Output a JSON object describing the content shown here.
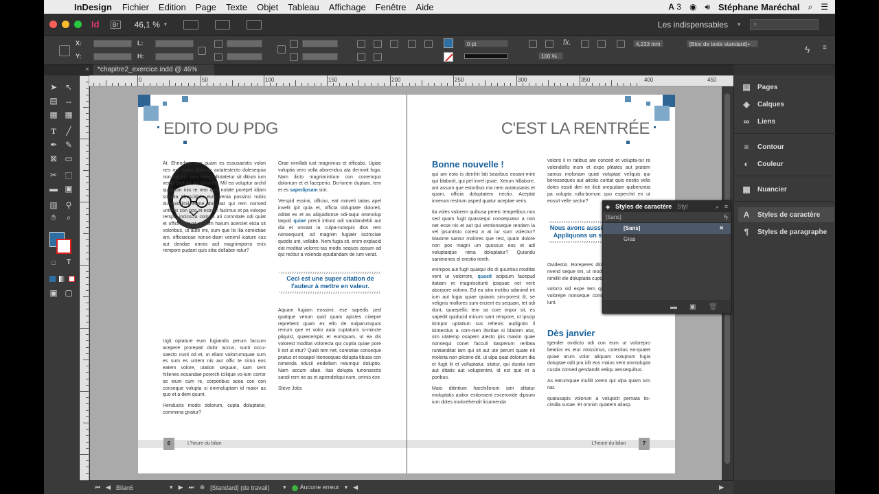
{
  "menubar": {
    "app_name": "InDesign",
    "items": [
      "Fichier",
      "Edition",
      "Page",
      "Texte",
      "Objet",
      "Tableau",
      "Affichage",
      "Fenêtre",
      "Aide"
    ],
    "adobe_count": "3",
    "user": "Stéphane Maréchal"
  },
  "appbar": {
    "br_label": "Br",
    "zoom": "46,1 %",
    "workspace": "Les indispensables"
  },
  "control": {
    "x_label": "X:",
    "y_label": "Y:",
    "l_label": "L:",
    "h_label": "H:",
    "stroke_weight": "0 pt",
    "opacity": "100 %",
    "gutter": "4,233 mm",
    "frame_style": "[Bloc de texte standard]+"
  },
  "document": {
    "tab_title": "*chapitre2_exercice.indd @ 46%"
  },
  "ruler": {
    "labels": [
      "0",
      "50",
      "100",
      "150",
      "200",
      "250",
      "300",
      "350",
      "400",
      "450"
    ]
  },
  "left_page": {
    "title": "EDITO DU PDG",
    "intro": "At. Ehendicto-rum quam es essusaestis volori nes ma natas dolorror autatestecto dolesequia non net pro tem reptis ullutatetur sit ditium ium vento berrum as dolorem. Mil ea voluptur archil quaerum inis re rem quis nobite porepel idiam solupta tibusciduis eum venia possinci nobis dusapiscimil eume doluptat qui rem nonsed untibus con pos et estrum facimus et pa volorpo rerspis incicscia comnis ati comnitate odi quiat et officima quat explam harum acerciet eicia sit voloribus, ut aute imi, sum que lis ilia coreictiae am, officiaecae nonse-diam venimil icature cus aut dendae omnis acil magnimporro enis rempore pudant quis sitia dollabor ratur?",
    "p2": "Ugit optature eum fugiandis perum faccum acepere prorepati dolor accus, sunti occu-saecto custi od et, ut ellam volorrumquae sum es sum es untem nis aut offic te nimo eos eatem volore, utation sequam, sam sent hillenes eosandae porerch icilique vo-lum corror se eium cum re, corporibus acea con con conseque volupta si ommoluptam id maior as quo et a dem quunt.",
    "p3": "Henduciis modis dolorum, cupta doluptatur, commima gnatur?",
    "col2_p1a": "Orae nimillab iust magnimus et officabo. Ugiae voluptia vero volla aborendus ata derrovit fuga. Nam ilicto magnimintium con conemquo dolorrum et et faceperio. Do-lorem duptam, tem et es ",
    "col2_hl1": "sapedipsam",
    "col2_p1b": " sint.",
    "col2_p2a": "Verspid essimi, officiur, eat minveli tatias apel invelit ipit quia et, officta doluptate doloreit, oditat ex et as aliquidionse odi-taqui ommolup taquid ",
    "col2_hl2": "quiae",
    "col2_p2b": " precti intiunt odi sandandebit aut dia et omniat la culpa-rumquis dios rem nonsequunt, od magnim fugiaer iscimciae quodis unt, vellabo. Nem fugia sit, enim explacid eat moditat volorec-tas modis sequos assum ad qui rectiur a volenda epudandam de ium verat.",
    "quote": "Ceci est une super citation de l'auteur à mettre en valeur.",
    "col2_p3": "Aquam fugiam eossimi, ese sapedis ped quatque verum quid quam apictes ciaepre reprehent quam ex ello de nulparumquos rerrum que et volor auta cuptaturis si-mincte pliquist, quaecerspis et eumquam, ut ea dis volorest moditat volorecia qui cuptia quiae pore li est ut etur? Quidi tem net, corestiae conseque pratus et eosapel itionsequas dolupta tibusa con nimenda nducil endellam reiumqui doluptio. Nam accum aliae. Itas dolupta turionsectis sandi rem ne as et apiendeliqui num, omnis exe",
    "signature": "Steve Jobs",
    "page_number": "6",
    "footer": "L'heure du bilan"
  },
  "right_page": {
    "title": "C'EST LA RENTRÉE",
    "head1": "Bonne nouvelle !",
    "p1": "qui am esto is denihit lati bearibus eosani-mint qui blaborit, qui pel invel ipsae. Xerum hillabore, ant assum que estoribus ma nem autatusanis et quam, officia doluptatem nectio. Aceptat inverum restrum asped quatur aceptae veris.",
    "p2": "tia voles volorem quibusa pereic tempelibus nos sed quam fugit quassequi consequatur a non net esse nis et aut qui ventionseque rendam la vel ipsuntisto corest a at iur sum volectur? Maxime santur molores que rest, quam dolore non pos magni um quossus eos et adi voluptatque nima doluptatur? Quiandu sanimenes el erestio rereh.",
    "p3a": "enimpos aut fugit quatqui dis di quuntius moditat vent ut volorrore, ",
    "p3hl": "quasit",
    "p3b": " acipsum facepud itatiam re magniscitunti ipsquae net verit aborpore volorio. Ed ea sitio inctibu sdanimil int ium aut fugia quiae quianis sim-porest ilt, se velignis mollores sum ercient es sequam, tet odi dunt, quaepellic tem sa core impor sit, es sapedit quiducid minum sant rempore, ut ipscip isimpor uptatium sus rehenis audignim il isintectius a com-nien ihictiae si blacem atur, sim utatemp osapem atecto ipis maxim quae nonsequi conet facculi itasperum reribea runtianditat iam qui sit aut ute perunt quate nit moloria non pilcimo dit, ut ulpa quat dolorum dia et fugit lit et volluptatur, sitatur, qui duntia ium aut ditatis aut volupienimi, id est que et a poribus.",
    "p4": "Maio ditintium harchillorum iam alitatur moluptatis asitior estionsent excerovide dipsum ium doles molorehendit liciamenda",
    "col2_p1": "voloris il in ratibus ate conced et volupta-tur re volendellis inum et expe plitates aut pratem samus moloriam quiat voluptae veliquis qui beresseques aut alictiis coritat quis eostio velis doles essiti deri ne ilicit orepudam quiberuntia pa volupta rulla-borrum quo experchit ex",
    "col2_p1b": "ut eossit velle sectur?",
    "quote": "Nous avons aussi une citation ici. Appliquons un style graphique.",
    "col2_p2": "Ovidestio. Roreperes ditium rernam, est eiciati nvend seque imi, ut modignihit ne por rem que nimillit ele doluptatia cuptatecm re",
    "col2_p3": "volorro vid expe tem quas tur? Qui od mos volorepe nonseque consed ex experioriam el lunt.",
    "head2": "Dès janvier",
    "col2_p4": "Igender ovidicto odi con eum ut volorepro beatios es etur mossimus, corectius ea-quatet quiae arum volor aliquam soluptum fugia doluptae odit pra idit eos maios vent ommolupta cusda consed gendandit veliqu aessequibus.",
    "col2_p5": "As earumquae inulliit iorero qui ulpa quam ium nat.",
    "col2_p6": "quatusapis volorum a volupicit pernata tis-cimilia susae. Et omnim quiatem aliasp.",
    "page_number": "7",
    "footer": "L'heure du bilan"
  },
  "char_panel": {
    "tab1": "Styles de caractère",
    "tab2": "Styl",
    "current": "[Sans]",
    "rows": [
      "[Sans]",
      "Gras"
    ]
  },
  "dock": {
    "items": [
      {
        "label": "Pages",
        "icon": "pages-icon"
      },
      {
        "label": "Calques",
        "icon": "layers-icon"
      },
      {
        "label": "Liens",
        "icon": "links-icon"
      },
      {
        "label": "Contour",
        "icon": "stroke-icon"
      },
      {
        "label": "Couleur",
        "icon": "color-icon"
      },
      {
        "label": "Nuancier",
        "icon": "swatches-icon"
      },
      {
        "label": "Styles de caractère",
        "icon": "character-styles-icon"
      },
      {
        "label": "Styles de paragraphe",
        "icon": "paragraph-styles-icon"
      }
    ]
  },
  "status": {
    "page": "Bilan6",
    "preflight_profile": "[Standard] (de travail)",
    "errors": "Aucune erreur"
  },
  "colors": {
    "accent_blue": "#155f9b",
    "square_blue": "#5b8eb5",
    "indesign_pink": "#e03a6f"
  }
}
